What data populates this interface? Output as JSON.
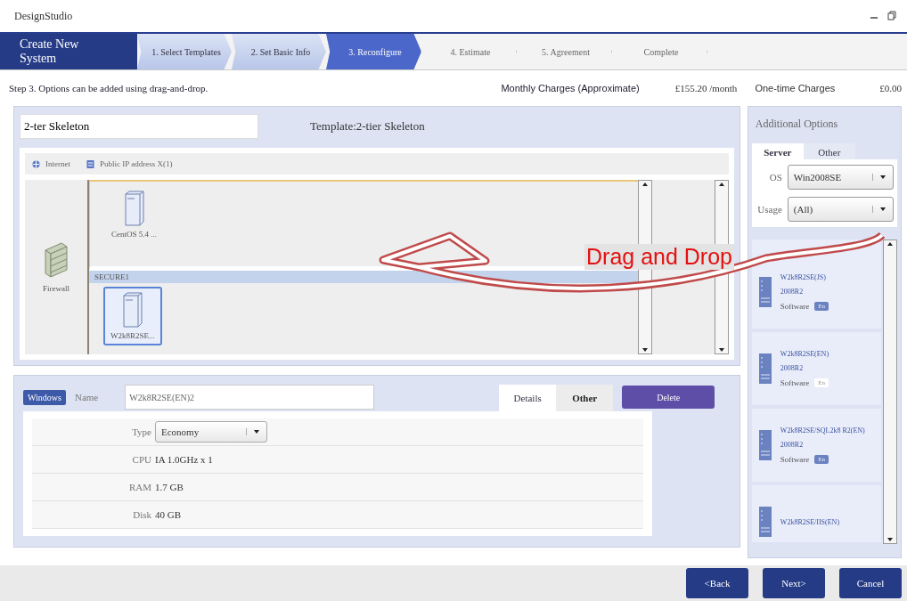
{
  "window": {
    "title": "DesignStudio"
  },
  "wizard": {
    "title": "Create New System",
    "steps": [
      {
        "label": "1. Select Templates",
        "done": true,
        "selected": false
      },
      {
        "label": "2. Set Basic Info",
        "done": true,
        "selected": false
      },
      {
        "label": "3. Reconfigure",
        "done": false,
        "selected": true
      },
      {
        "label": "4. Estimate",
        "done": false,
        "selected": false
      },
      {
        "label": "5. Agreement",
        "done": false,
        "selected": false
      },
      {
        "label": "Complete",
        "done": false,
        "selected": false
      }
    ]
  },
  "info": {
    "step": "Step 3. Options can be added using drag-and-drop.",
    "monthly_label": "Monthly Charges (Approximate)",
    "monthly_value": "£155.20 /month",
    "onetime_label": "One-time Charges",
    "onetime_value": "£0.00"
  },
  "system": {
    "name": "2-ter Skeleton",
    "template": "Template:2-tier Skeleton",
    "internet": "Internet",
    "public_ip": "Public IP address X(1)",
    "firewall": "Firewall",
    "segments": [
      {
        "servers": [
          {
            "name": "CentOS 5.4 ...",
            "selected": false
          }
        ]
      },
      {
        "label": "SECURE1",
        "servers": [
          {
            "name": "W2k8R2SE...",
            "selected": true
          }
        ]
      }
    ]
  },
  "details": {
    "os_tag": "Windows",
    "name_label": "Name",
    "name_value": "W2k8R2SE(EN)2",
    "tabs": [
      {
        "label": "Details",
        "selected": true
      },
      {
        "label": "Other",
        "selected": false
      }
    ],
    "delete": "Delete",
    "rows": [
      {
        "kind": "select",
        "label": "Type",
        "value": "Economy"
      },
      {
        "kind": "text",
        "label": "CPU",
        "value": "IA 1.0GHz x 1"
      },
      {
        "kind": "text",
        "label": "RAM",
        "value": "1.7 GB"
      },
      {
        "kind": "text",
        "label": "Disk",
        "value": "40 GB"
      }
    ]
  },
  "options": {
    "title": "Additional Options",
    "tabs": [
      {
        "label": "Server",
        "selected": true
      },
      {
        "label": "Other",
        "selected": false
      }
    ],
    "filters": [
      {
        "label": "OS",
        "value": "Win2008SE"
      },
      {
        "label": "Usage",
        "value": "(All)"
      }
    ],
    "items": [
      {
        "title": "W2k8R2SE(JS)",
        "version": "2008R2",
        "software_label": "Software",
        "badge": "En",
        "on": true
      },
      {
        "title": "W2k8R2SE(EN)",
        "version": "2008R2",
        "software_label": "Software",
        "badge": "En",
        "on": false
      },
      {
        "title": "W2k8R2SE/SQL2k8 R2(EN)",
        "version": "2008R2",
        "software_label": "Software",
        "badge": "En",
        "on": true
      },
      {
        "title": "W2k8R2SE/IIS(EN)"
      }
    ]
  },
  "annotation": "Drag and Drop",
  "buttons": [
    {
      "label": "<Back"
    },
    {
      "label": "Next>"
    },
    {
      "label": "Cancel"
    }
  ]
}
